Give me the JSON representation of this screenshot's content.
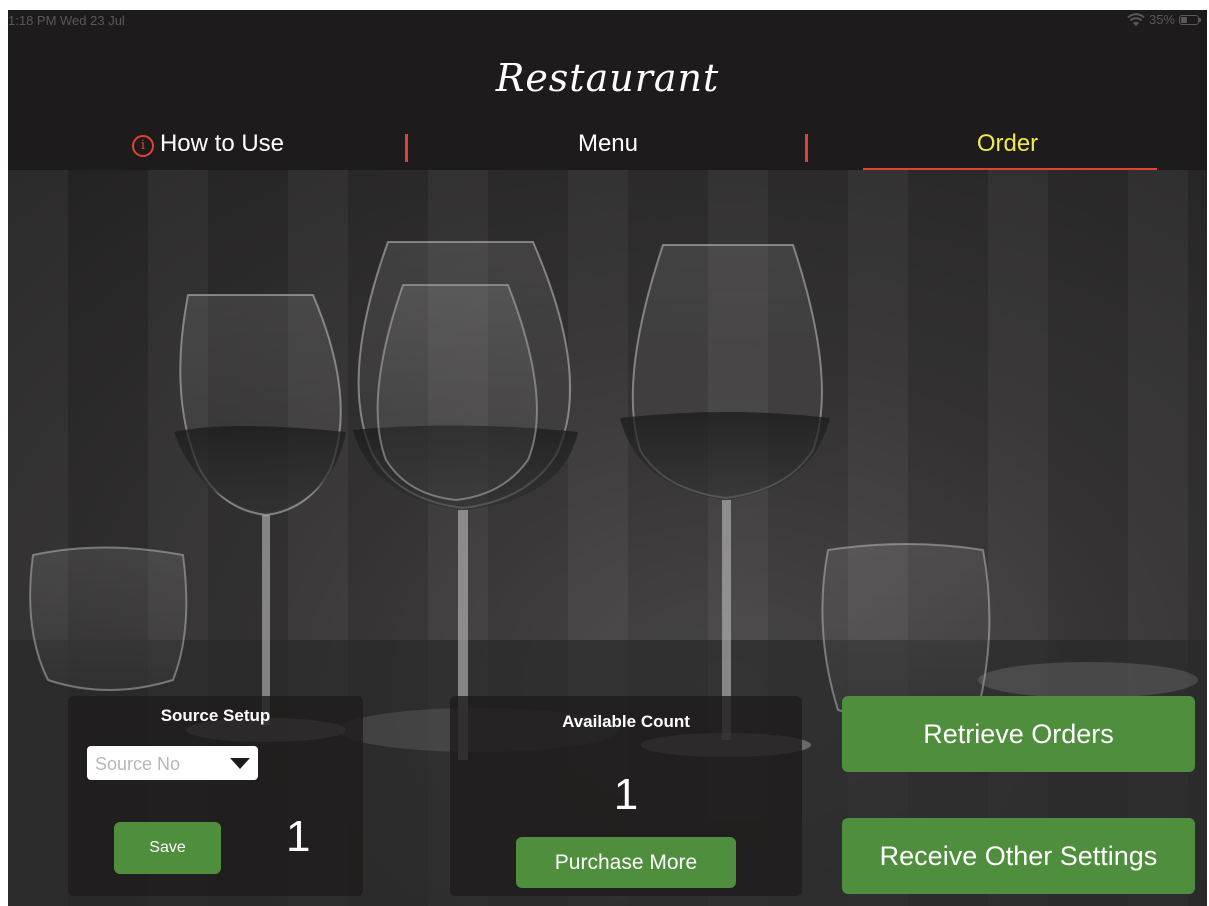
{
  "status_bar": {
    "time_date": "1:18 PM  Wed 23 Jul",
    "battery": "35%",
    "icons": [
      "wifi-icon",
      "battery-icon"
    ]
  },
  "app": {
    "title": "Restaurant"
  },
  "tabs": [
    {
      "label": "How to Use",
      "icon": "info-icon",
      "icon_glyph": "i",
      "selected": false
    },
    {
      "label": "Menu",
      "selected": false
    },
    {
      "label": "Order",
      "selected": true
    }
  ],
  "colors": {
    "accent_red": "#e0432f",
    "selected_tab": "#f0e94a",
    "button_green": "#4f8e3d",
    "bar_background": "#1d1b1b"
  },
  "source_setup": {
    "title": "Source Setup",
    "select_placeholder": "Source No",
    "save_label": "Save",
    "value": "1"
  },
  "available_count": {
    "title": "Available Count",
    "value": "1",
    "purchase_label": "Purchase More"
  },
  "actions": {
    "retrieve_label": "Retrieve Orders",
    "settings_label": "Receive Other Settings"
  }
}
